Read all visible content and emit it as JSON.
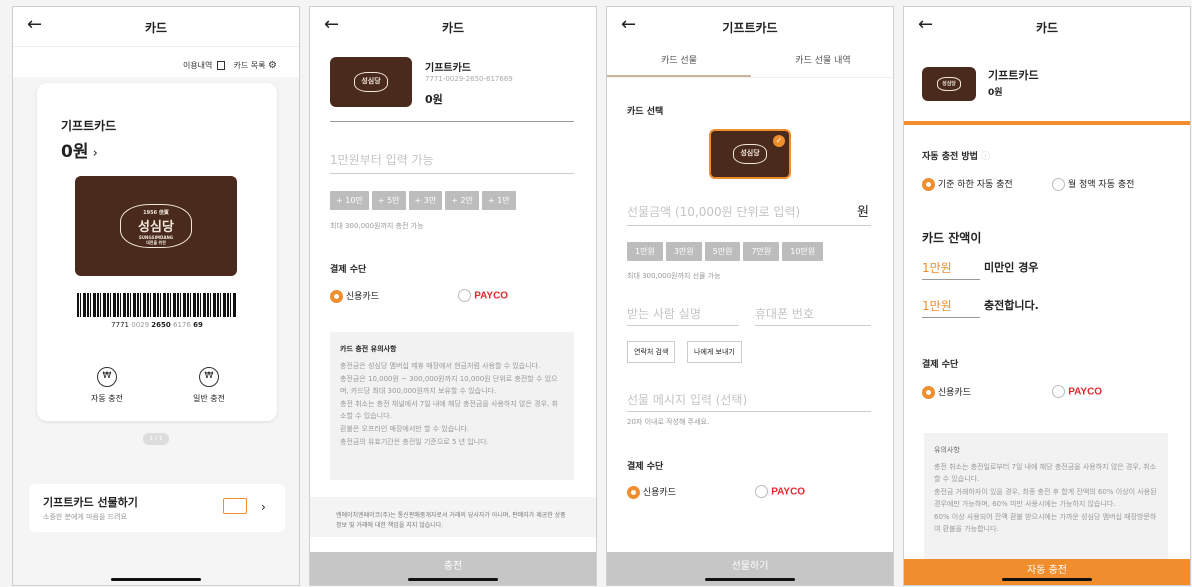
{
  "s1": {
    "title": "카드",
    "history": "이용내역",
    "cardlist": "카드 목록",
    "card_name": "기프트카드",
    "balance": "0원",
    "brand_top": "1956 佳賓",
    "brand_main": "성심당",
    "brand_sub": "SUNGSIMDANG",
    "brand_tag": "대전을 위한",
    "barcode_num_a": "7771",
    "barcode_num_b": "0029",
    "barcode_num_c": "2650",
    "barcode_num_d": "6176",
    "barcode_num_e": "69",
    "auto_charge": "자동 충전",
    "normal_charge": "일반 충전",
    "pager": "1 / 1",
    "gift_title": "기프트카드 선물하기",
    "gift_sub": "소중한 분에게 마음을 드려요"
  },
  "s2": {
    "title": "카드",
    "card_name": "기프트카드",
    "card_number": "7771-0029-2650-617669",
    "balance": "0원",
    "amount_placeholder": "1만원부터 입력 가능",
    "chips": [
      "+ 10만",
      "+ 5만",
      "+ 3만",
      "+ 2만",
      "+ 1만"
    ],
    "max_note": "최대 300,000원까지 충전 가능",
    "pay_title": "결제 수단",
    "credit": "신용카드",
    "payco": "PAYCO",
    "notice_title": "카드 충전 유의사항",
    "notices": [
      "충전금은 성심당 멤버십 제휴 매장에서 현금처럼 사용할 수 있습니다.",
      "충전금은 10,000원 ~ 300,000원까지 10,000원 단위로 충전할 수 있으며, 카드당 최대 300,000원까지 보유할 수 있습니다.",
      "충전 취소는 충전 채널에서 7일 내에 해당 충전금을 사용하지 않은 경우, 취소할 수 있습니다.",
      "환불은 오프라인 매장에서만 할 수 있습니다.",
      "충전금의 유효기간은 충전일 기준으로 5 년 입니다."
    ],
    "footer_text": "엔에이치엔페이코(주)는 통신판매중개자로서 거래의 당사자가 아니며, 판매자가 제공한 상품정보 및 거래에 대한 책임을 지지 않습니다.",
    "submit": "충전"
  },
  "s3": {
    "title": "기프트카드",
    "tab1": "카드 선물",
    "tab2": "카드 선물 내역",
    "select_title": "카드 선택",
    "amount_placeholder": "선물금액 (10,000원 단위로 입력)",
    "won": "원",
    "chips": [
      "1만원",
      "3만원",
      "5만원",
      "7만원",
      "10만원"
    ],
    "max_note": "최대 300,000원까지 선물 가능",
    "name_placeholder": "받는 사람 실명",
    "phone_placeholder": "휴대폰 번호",
    "contact_btn": "연락처 검색",
    "self_btn": "나에게 보내기",
    "msg_placeholder": "선물 메시지 입력 (선택)",
    "msg_note": "20자 이내로 작성해 주세요.",
    "pay_title": "결제 수단",
    "credit": "신용카드",
    "payco": "PAYCO",
    "submit": "선물하기"
  },
  "s4": {
    "title": "카드",
    "card_name": "기프트카드",
    "balance": "0원",
    "method_title": "자동 충전 방법",
    "opt1": "기준 하한 자동 충전",
    "opt2": "월 정액 자동 충전",
    "balance_title": "카드 잔액이",
    "threshold": "1만원",
    "below": "미만인 경우",
    "charge_amt": "1만원",
    "charge_text": "충전합니다.",
    "pay_title": "결제 수단",
    "credit": "신용카드",
    "payco": "PAYCO",
    "notice_title": "유의사항",
    "notices": [
      "충전 취소는 충전일로부터 7일 내에 해당 충전금을 사용하지 않은 경우, 취소할 수 있습니다.",
      "충전금 거래하자이 있을 경우, 최종 충전 후 합계 잔액의 60% 이상이 사용된 경우에만 가능하며, 60% 미만 사용시에는 가능하지 않습니다.",
      "60% 이상 사용되어 잔액 환불 받으시에는 가까운 성심당 멤버십 매장방문하여 환불을 가능합니다."
    ],
    "submit": "자동 충전"
  },
  "colors": {
    "accent": "#f08d2c",
    "card": "#4a2a1c",
    "payco": "#e3262c"
  }
}
